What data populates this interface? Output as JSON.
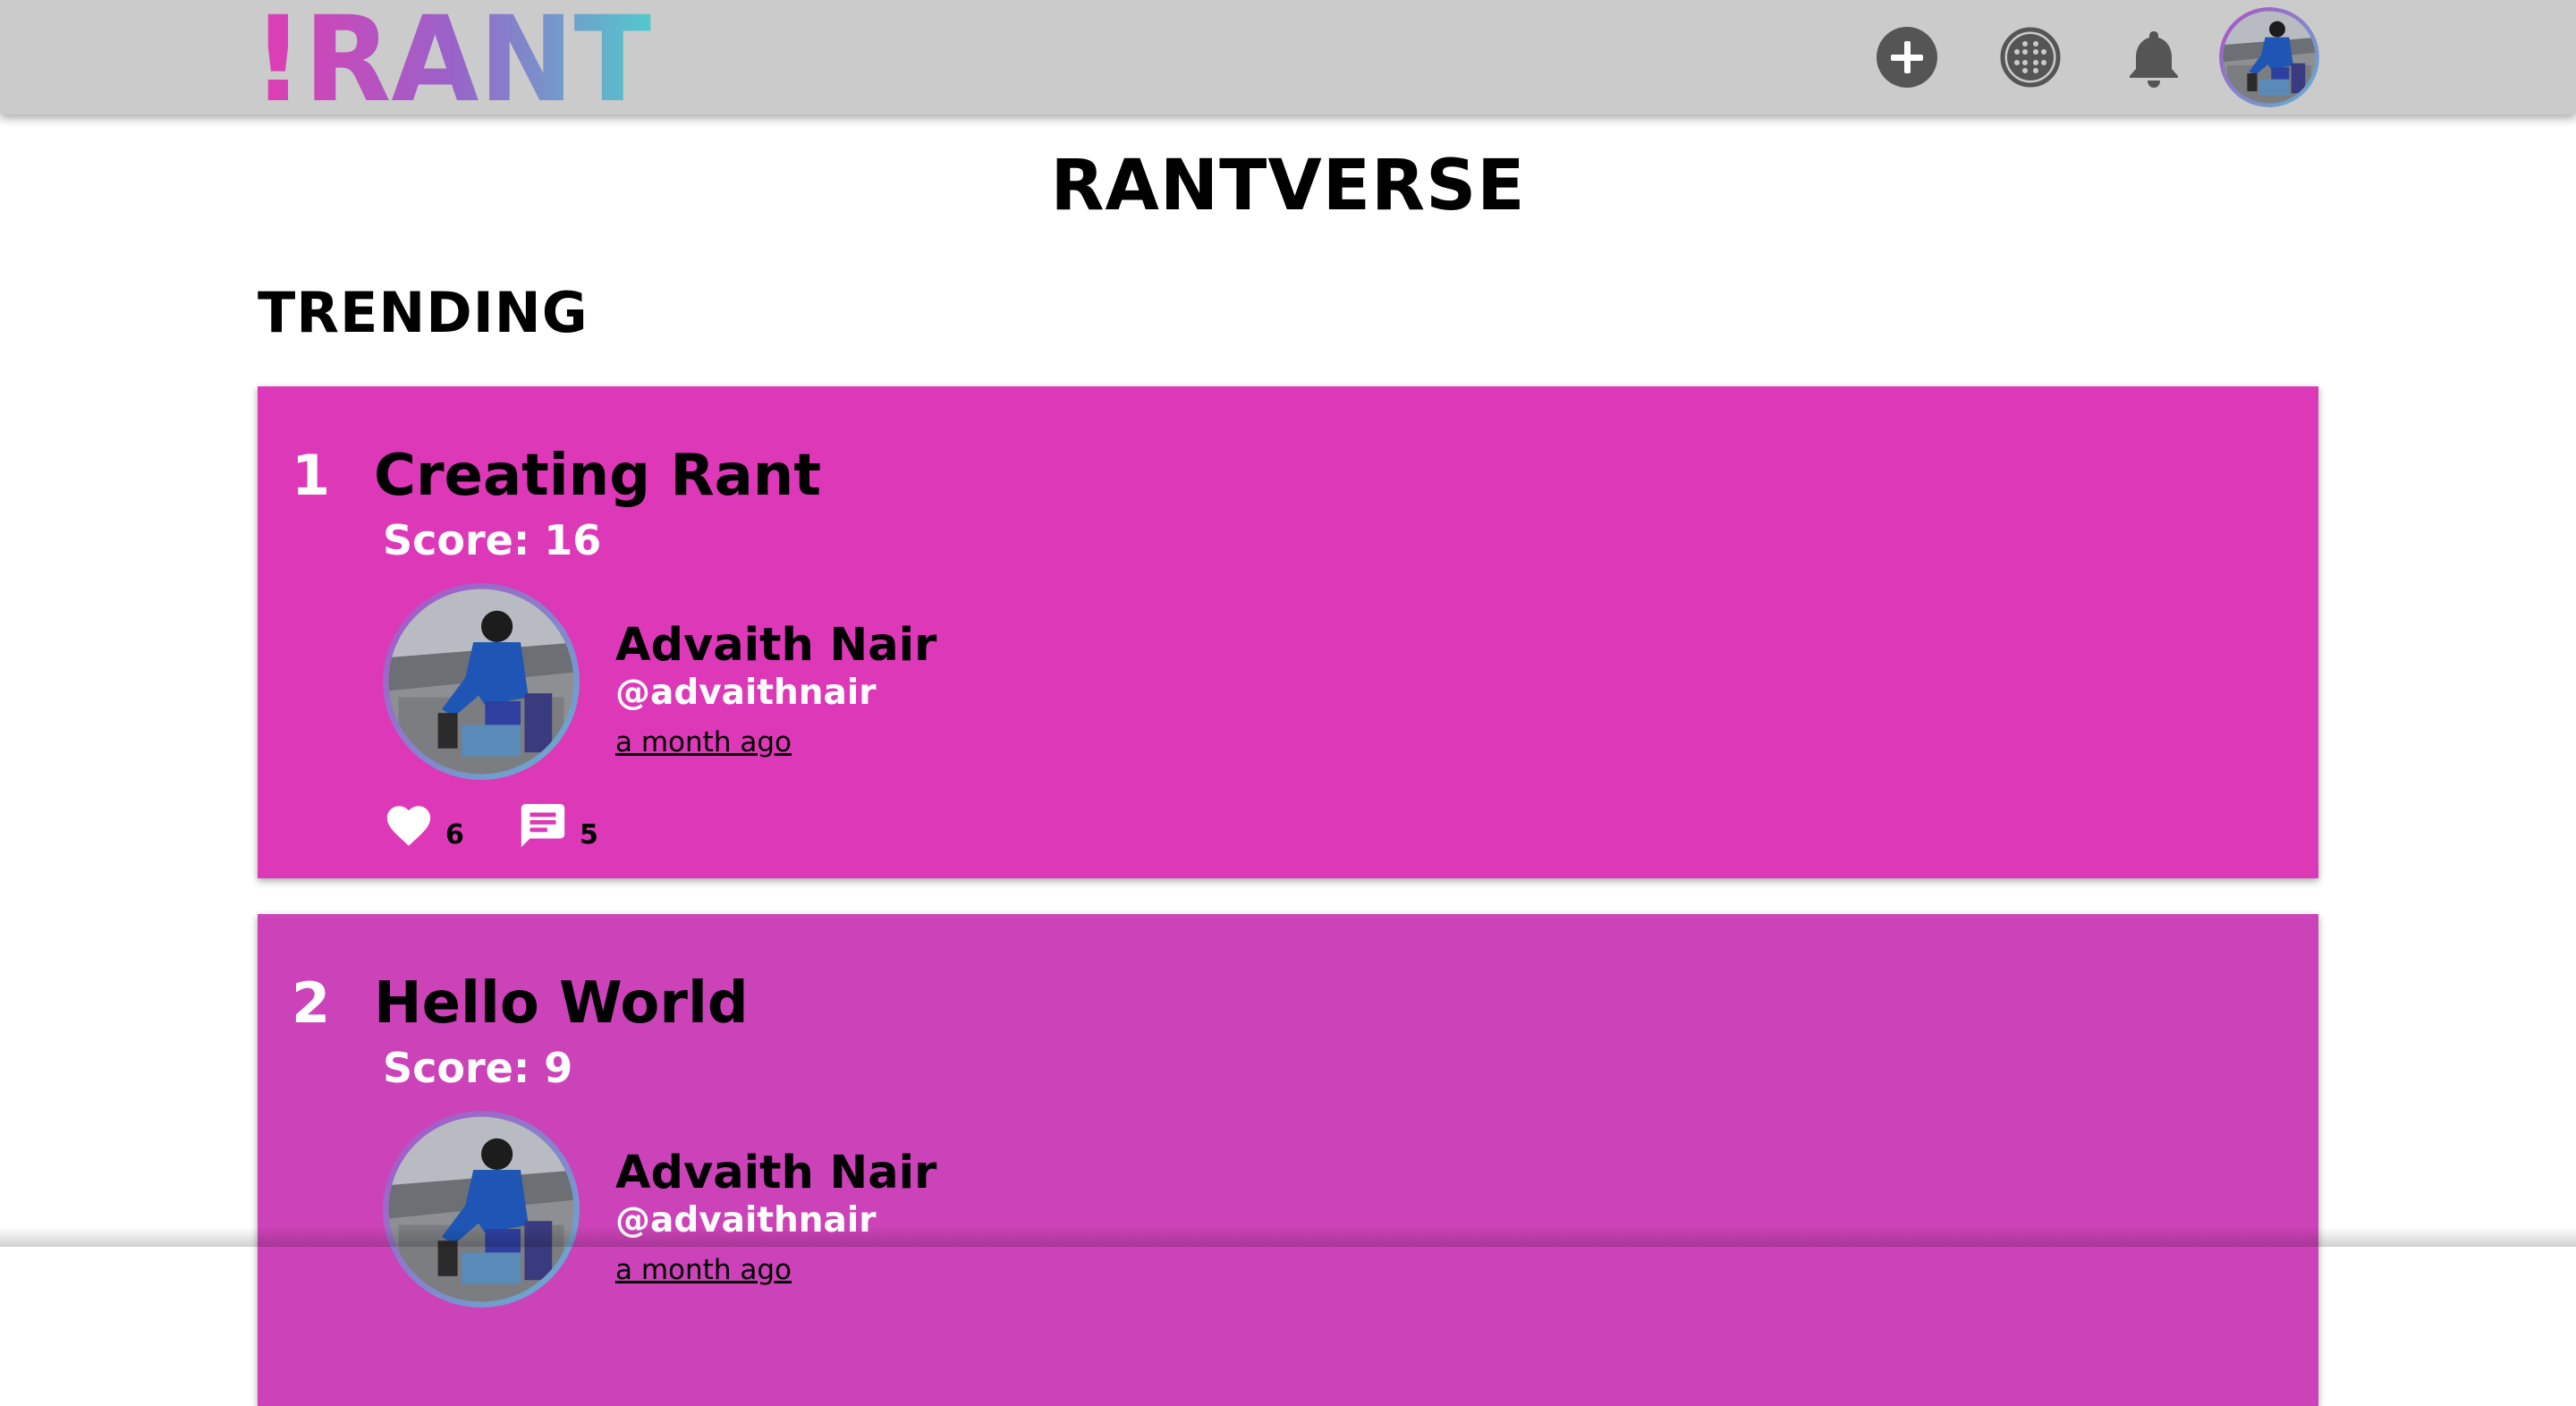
{
  "header": {
    "logo_text": "!RANT",
    "icons": [
      "add-icon",
      "grid-icon",
      "bell-icon",
      "user-avatar"
    ],
    "logo_gradient": [
      "#e33bb3",
      "#9a62c9",
      "#52c9cc"
    ]
  },
  "page": {
    "title": "RANTVERSE",
    "section_title": "TRENDING"
  },
  "rants": [
    {
      "rank": "1",
      "title": "Creating Rant",
      "score": "Score: 16",
      "author_name": "Advaith Nair",
      "author_handle": "@advaithnair",
      "time": "a month ago",
      "likes": "6",
      "comments": "5",
      "color": "#dd38b8"
    },
    {
      "rank": "2",
      "title": "Hello World",
      "score": "Score: 9",
      "author_name": "Advaith Nair",
      "author_handle": "@advaithnair",
      "time": "a month ago",
      "likes": "",
      "comments": "",
      "color": "#cc42b8"
    }
  ]
}
